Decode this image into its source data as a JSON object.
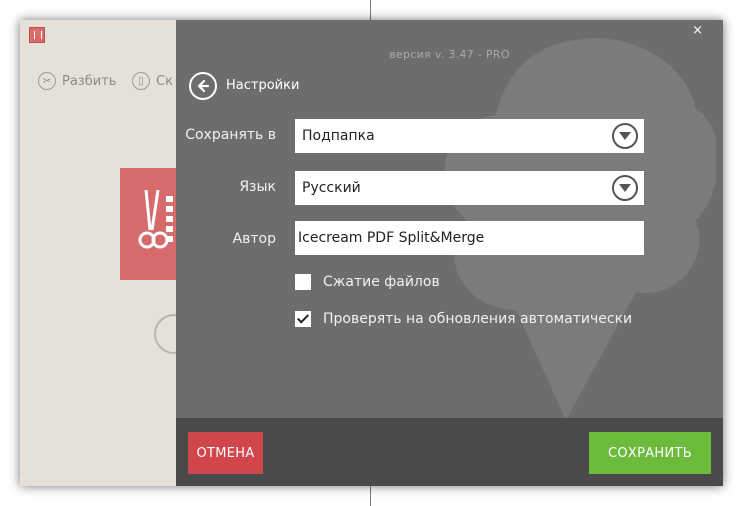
{
  "app": {
    "toolbar": [
      {
        "label": "Разбить",
        "icon": "scissors-icon"
      },
      {
        "label": "Ск",
        "icon": "merge-icon"
      }
    ]
  },
  "dialog": {
    "version": "версия v. 3.47 - PRO",
    "close_symbol": "×",
    "title": "Настройки",
    "fields": {
      "save_in": {
        "label": "Сохранять в",
        "value": "Подпапка"
      },
      "language": {
        "label": "Язык",
        "value": "Русский"
      },
      "author": {
        "label": "Автор",
        "value": "Icecream PDF Split&Merge"
      }
    },
    "checkboxes": [
      {
        "label": "Сжатие файлов",
        "checked": false
      },
      {
        "label": "Проверять на обновления автоматически",
        "checked": true
      }
    ],
    "buttons": {
      "cancel": "ОТМЕНА",
      "save": "СОХРАНИТЬ"
    }
  },
  "colors": {
    "dialog_bg": "#6d6d6d",
    "footer_bg": "#4a4a4a",
    "cancel": "#d0464b",
    "save": "#6cbb3c",
    "app_accent": "#d76a6a"
  }
}
